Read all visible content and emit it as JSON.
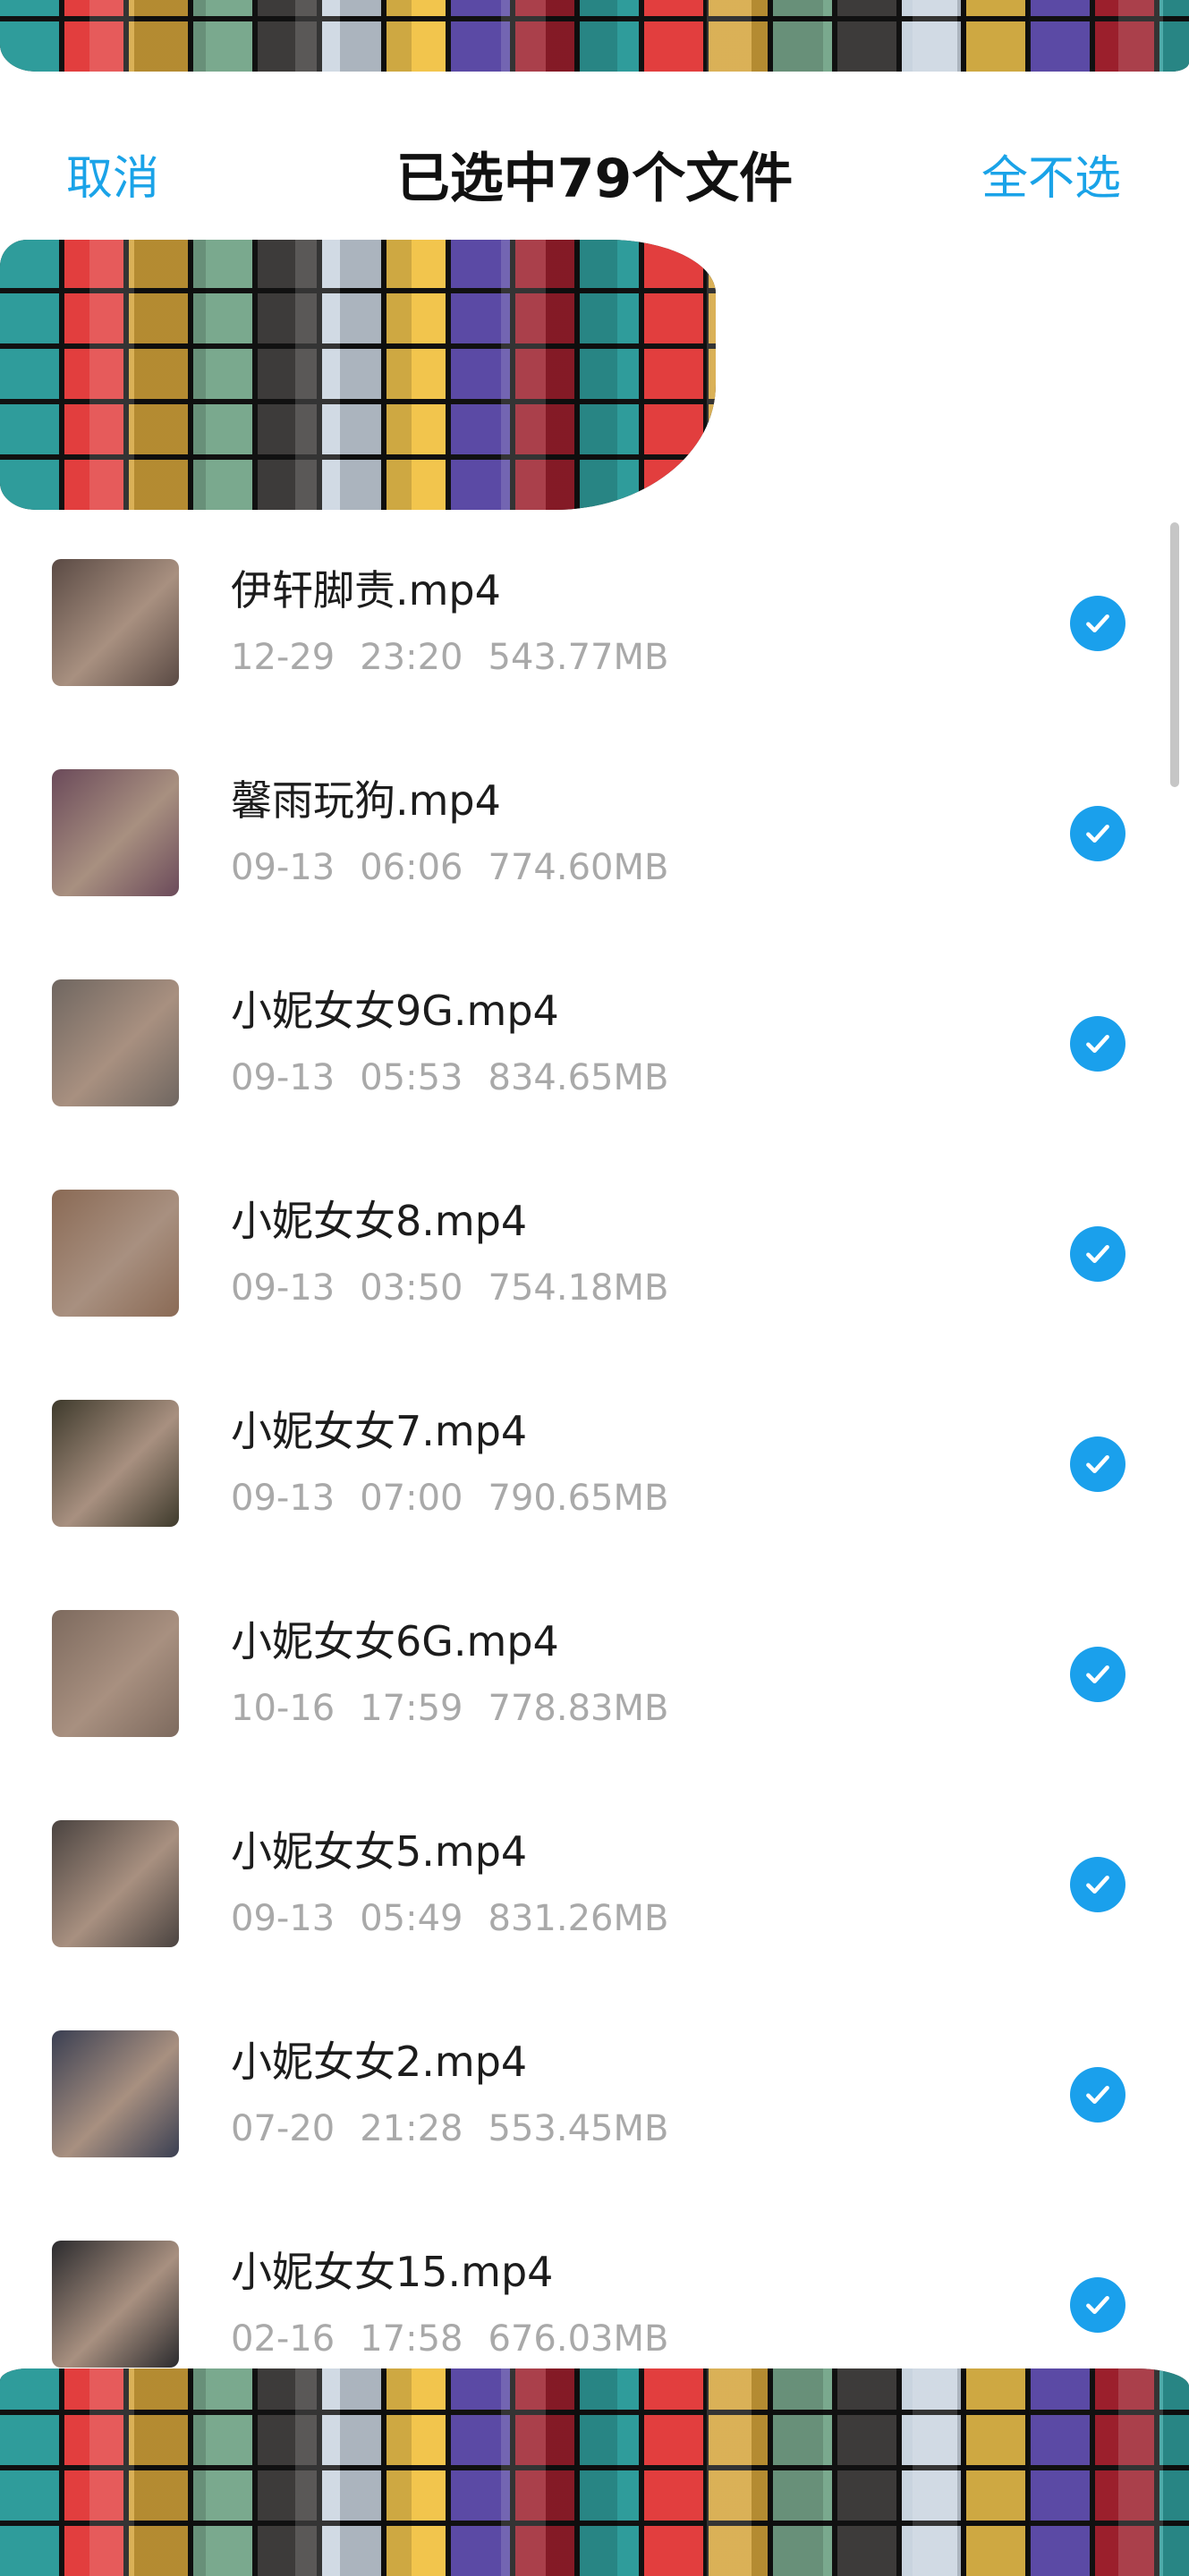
{
  "header": {
    "cancel_label": "取消",
    "title": "已选中79个文件",
    "deselect_all_label": "全不选"
  },
  "files": [
    {
      "name": "伊轩脚责.mp4",
      "date": "12-29",
      "time": "23:20",
      "size": "543.77MB",
      "selected": true
    },
    {
      "name": "馨雨玩狗.mp4",
      "date": "09-13",
      "time": "06:06",
      "size": "774.60MB",
      "selected": true
    },
    {
      "name": "小妮女女9G.mp4",
      "date": "09-13",
      "time": "05:53",
      "size": "834.65MB",
      "selected": true
    },
    {
      "name": "小妮女女8.mp4",
      "date": "09-13",
      "time": "03:50",
      "size": "754.18MB",
      "selected": true
    },
    {
      "name": "小妮女女7.mp4",
      "date": "09-13",
      "time": "07:00",
      "size": "790.65MB",
      "selected": true
    },
    {
      "name": "小妮女女6G.mp4",
      "date": "10-16",
      "time": "17:59",
      "size": "778.83MB",
      "selected": true
    },
    {
      "name": "小妮女女5.mp4",
      "date": "09-13",
      "time": "05:49",
      "size": "831.26MB",
      "selected": true
    },
    {
      "name": "小妮女女2.mp4",
      "date": "07-20",
      "time": "21:28",
      "size": "553.45MB",
      "selected": true
    },
    {
      "name": "小妮女女15.mp4",
      "date": "02-16",
      "time": "17:58",
      "size": "676.03MB",
      "selected": true
    }
  ],
  "thumbnail_colors": [
    "#5a4a44",
    "#6b4a5a",
    "#6f6660",
    "#8a6a55",
    "#3e3a2c",
    "#7d6a5e",
    "#4a4340",
    "#3a3f52",
    "#2b2b2e"
  ],
  "accent_color": "#1aa0ec",
  "icons": {
    "check": "check-circle-icon"
  }
}
